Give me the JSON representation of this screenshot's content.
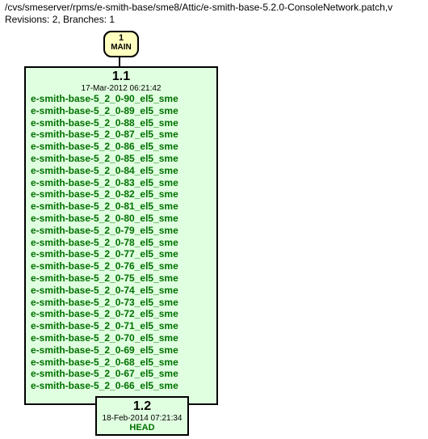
{
  "header": {
    "path": "/cvs/smeserver/rpms/e-smith-base/sme8/Attic/e-smith-base-5.2.0-ConsoleNetwork.patch,v",
    "revinfo": "Revisions: 2, Branches: 1"
  },
  "main_node": {
    "number": "1",
    "label": "MAIN"
  },
  "rev1": {
    "number": "1.1",
    "date": "17-Mar-2012 06:21:42",
    "tags": [
      "e-smith-base-5_2_0-90_el5_sme",
      "e-smith-base-5_2_0-89_el5_sme",
      "e-smith-base-5_2_0-88_el5_sme",
      "e-smith-base-5_2_0-87_el5_sme",
      "e-smith-base-5_2_0-86_el5_sme",
      "e-smith-base-5_2_0-85_el5_sme",
      "e-smith-base-5_2_0-84_el5_sme",
      "e-smith-base-5_2_0-83_el5_sme",
      "e-smith-base-5_2_0-82_el5_sme",
      "e-smith-base-5_2_0-81_el5_sme",
      "e-smith-base-5_2_0-80_el5_sme",
      "e-smith-base-5_2_0-79_el5_sme",
      "e-smith-base-5_2_0-78_el5_sme",
      "e-smith-base-5_2_0-77_el5_sme",
      "e-smith-base-5_2_0-76_el5_sme",
      "e-smith-base-5_2_0-75_el5_sme",
      "e-smith-base-5_2_0-74_el5_sme",
      "e-smith-base-5_2_0-73_el5_sme",
      "e-smith-base-5_2_0-72_el5_sme",
      "e-smith-base-5_2_0-71_el5_sme",
      "e-smith-base-5_2_0-70_el5_sme",
      "e-smith-base-5_2_0-69_el5_sme",
      "e-smith-base-5_2_0-68_el5_sme",
      "e-smith-base-5_2_0-67_el5_sme",
      "e-smith-base-5_2_0-66_el5_sme"
    ],
    "more": "..."
  },
  "rev2": {
    "number": "1.2",
    "date": "18-Feb-2014 07:21:34",
    "head": "HEAD"
  }
}
